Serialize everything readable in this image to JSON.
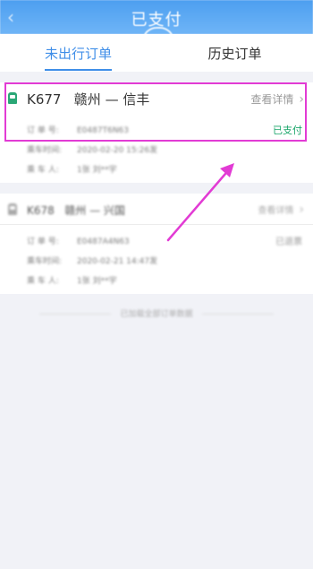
{
  "header": {
    "title": "已支付"
  },
  "tabs": [
    {
      "label": "未出行订单",
      "active": true
    },
    {
      "label": "历史订单",
      "active": false
    }
  ],
  "orders": [
    {
      "train": "K677",
      "from": "赣州",
      "sep": "—",
      "to": "信丰",
      "detail_link": "查看详情",
      "status": "已支付",
      "rows": [
        {
          "label": "订 单 号:",
          "value": "E0487T6N63"
        },
        {
          "label": "乘车时间:",
          "value": "2020-02-20  15:26发"
        },
        {
          "label": "乘 车 人:",
          "value": "1张  刘**宇"
        }
      ]
    },
    {
      "train": "K678",
      "from": "赣州",
      "sep": "—",
      "to": "兴国",
      "detail_link": "查看详情",
      "status": "已退票",
      "rows": [
        {
          "label": "订 单 号:",
          "value": "E0487A4N63"
        },
        {
          "label": "乘车时间:",
          "value": "2020-02-21  14:47发"
        },
        {
          "label": "乘 车 人:",
          "value": "1张  刘**宇"
        }
      ]
    }
  ],
  "footer": {
    "note": "已加载全部订单数据"
  },
  "colors": {
    "accent": "#3f8ee8",
    "paid": "#1aa66a",
    "highlight": "#e23bd4",
    "train_icon": "#2aa776"
  },
  "icons": {
    "back": "back-arrow-icon",
    "train": "train-icon",
    "chevron": "chevron-right-icon"
  }
}
